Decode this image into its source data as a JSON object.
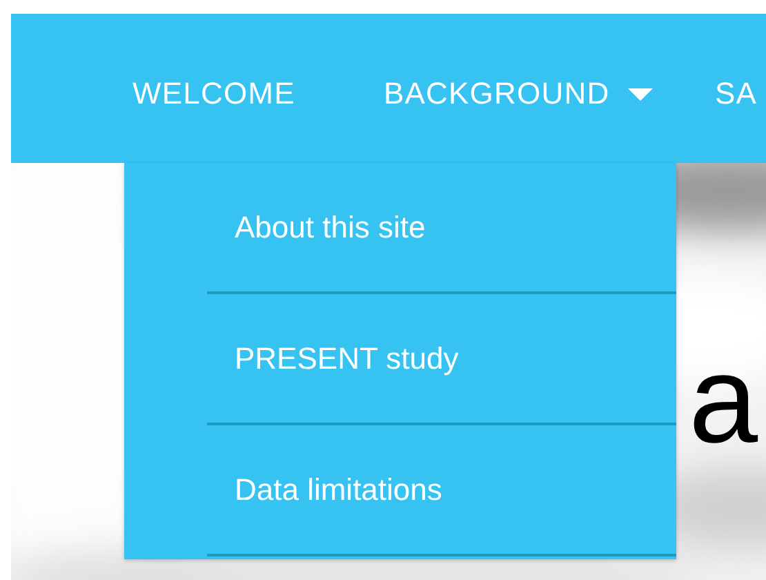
{
  "nav": {
    "items": [
      {
        "label": "WELCOME",
        "kind": "link"
      },
      {
        "label": "BACKGROUND",
        "kind": "dropdown",
        "expanded": true,
        "menu": [
          {
            "label": "About this site"
          },
          {
            "label": "PRESENT study"
          },
          {
            "label": "Data limitations"
          }
        ]
      },
      {
        "label": "SA",
        "kind": "link"
      }
    ]
  },
  "hero": {
    "kind": "picture",
    "heading": "a"
  }
}
